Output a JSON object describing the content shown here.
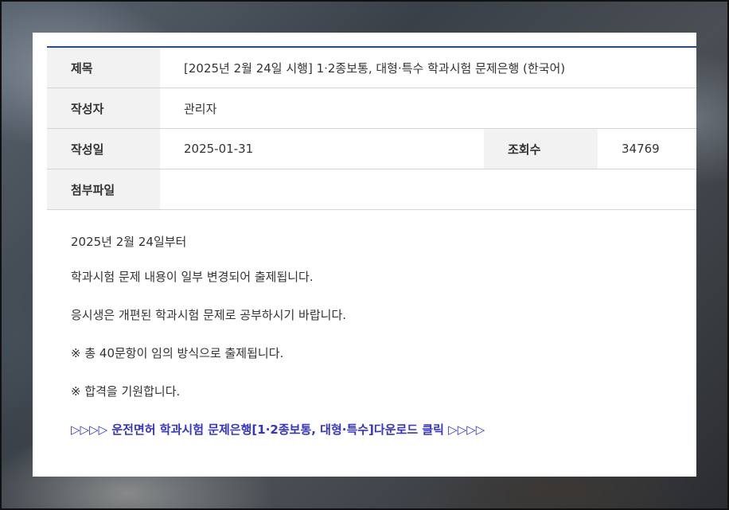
{
  "post": {
    "title_label": "제목",
    "title": "[2025년 2월 24일 시행] 1·2종보통, 대형·특수 학과시험 문제은행 (한국어)",
    "author_label": "작성자",
    "author": "관리자",
    "date_label": "작성일",
    "date": "2025-01-31",
    "views_label": "조회수",
    "views": "34769",
    "attachment_label": "첨부파일",
    "attachment": ""
  },
  "content": {
    "lines": [
      "2025년 2월 24일부터",
      "학과시험 문제 내용이 일부 변경되어 출제됩니다.",
      "응시생은 개편된 학과시험 문제로 공부하시기 바랍니다.",
      "※ 총 40문항이 임의 방식으로 출제됩니다.",
      "※ 합격을 기원합니다."
    ],
    "download_link": "▷▷▷▷ 운전면허 학과시험 문제은행[1·2종보통, 대형·특수]다운로드 클릭 ▷▷▷▷"
  },
  "colors": {
    "header_border": "#1f4f8f",
    "label_bg": "#f2f2f2",
    "link": "#3434c8"
  }
}
